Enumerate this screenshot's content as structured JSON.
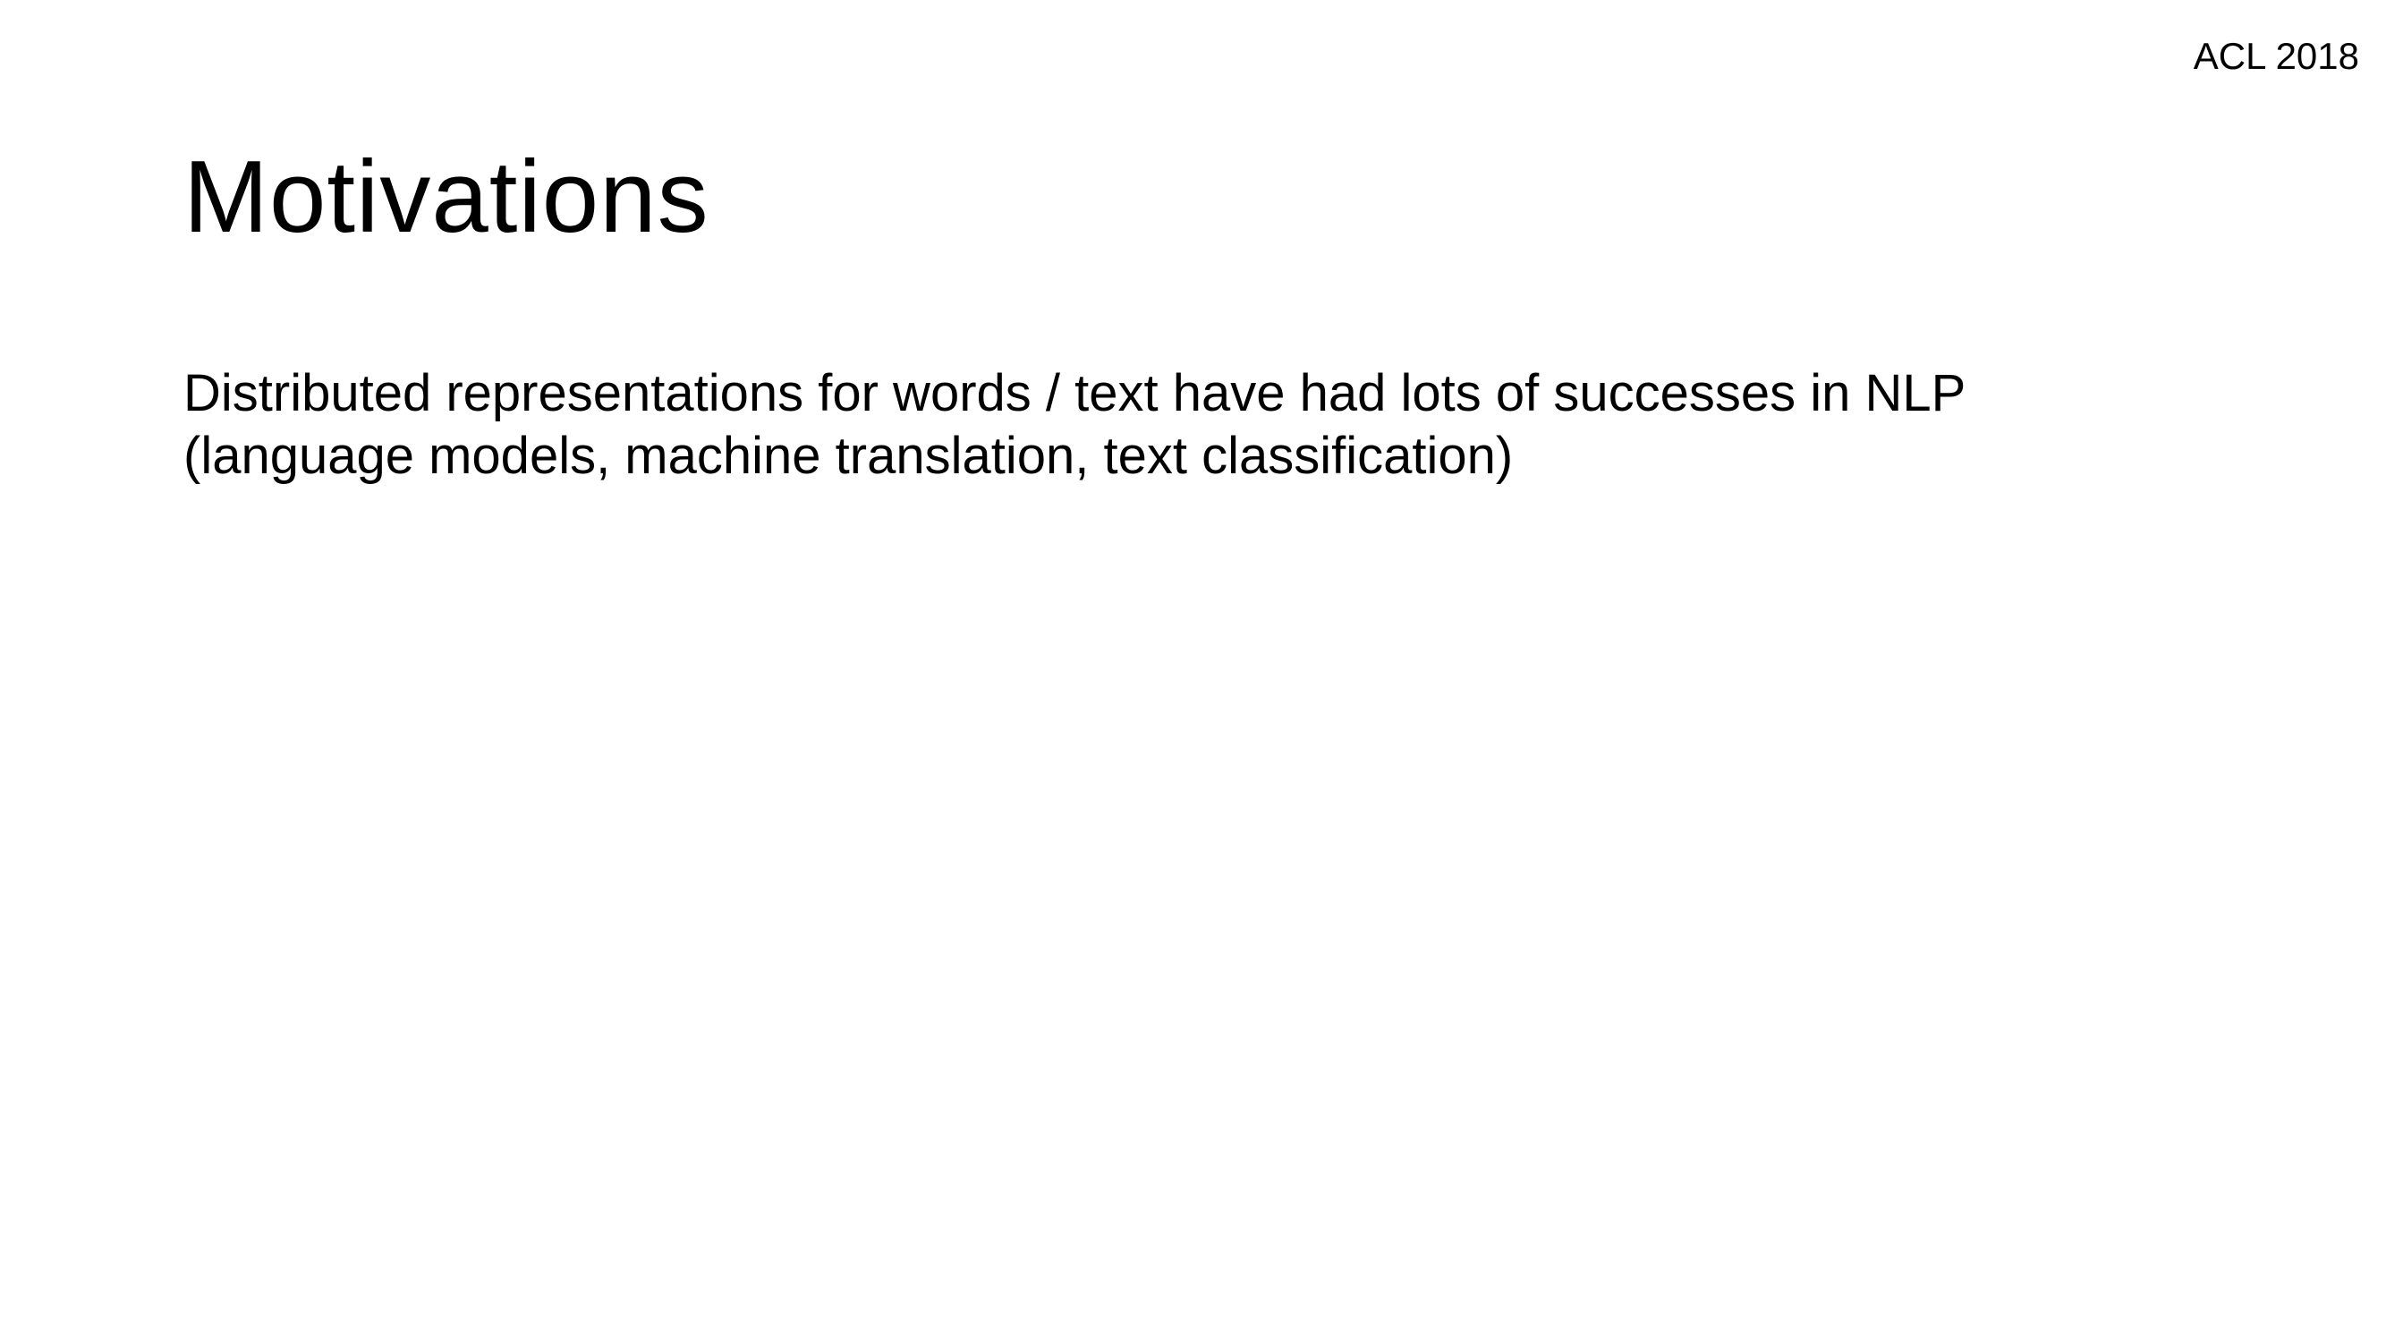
{
  "slide": {
    "header_tag": "ACL 2018",
    "title": "Motivations",
    "body": {
      "line1": "Distributed representations for words / text have had lots of successes in NLP",
      "line2": "(language models, machine translation, text classification)"
    }
  }
}
